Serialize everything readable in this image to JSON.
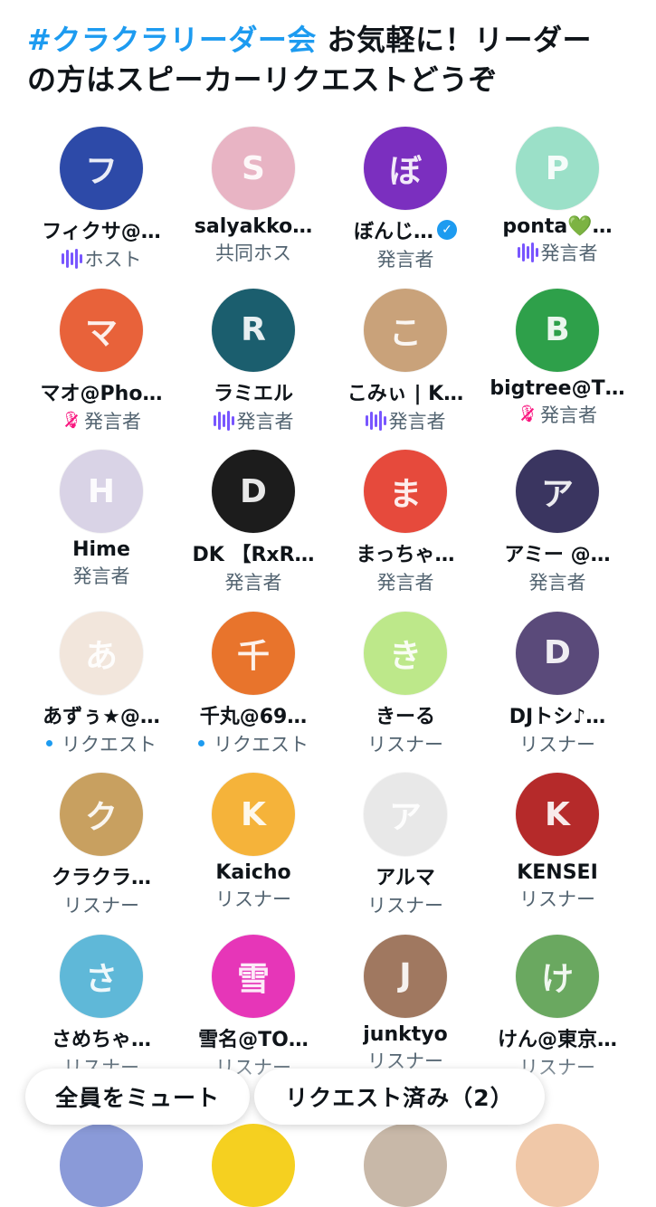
{
  "header": {
    "hashtag": "#クラクラリーダー会",
    "text": " お気軽に！リーダーの方はスピーカーリクエストどうぞ"
  },
  "participants": [
    {
      "name": "フィクサ@…",
      "role": "ホスト",
      "indicator": "wave",
      "avatar_color": "#2d4aa8",
      "avatar_glyph": "フ"
    },
    {
      "name": "salyakko…",
      "role": "共同ホス",
      "indicator": "none",
      "avatar_color": "#e8b4c4",
      "avatar_glyph": "S"
    },
    {
      "name": "ぼんじ…",
      "role": "発言者",
      "indicator": "none",
      "verified": true,
      "avatar_color": "#7b2fbf",
      "avatar_glyph": "ぼ"
    },
    {
      "name": "ponta💚…",
      "role": "発言者",
      "indicator": "wave",
      "avatar_color": "#9be0c8",
      "avatar_glyph": "P"
    },
    {
      "name": "マオ@Pho…",
      "role": "発言者",
      "indicator": "muted",
      "avatar_color": "#e8623a",
      "avatar_glyph": "マ"
    },
    {
      "name": "ラミエル",
      "role": "発言者",
      "indicator": "wave",
      "avatar_color": "#1b5e6e",
      "avatar_glyph": "R"
    },
    {
      "name": "こみぃ | K…",
      "role": "発言者",
      "indicator": "wave",
      "avatar_color": "#c9a27a",
      "avatar_glyph": "こ"
    },
    {
      "name": "bigtree@T…",
      "role": "発言者",
      "indicator": "muted",
      "avatar_color": "#2ea04a",
      "avatar_glyph": "B"
    },
    {
      "name": "Hime",
      "role": "発言者",
      "indicator": "none",
      "avatar_color": "#d9d3e6",
      "avatar_glyph": "H"
    },
    {
      "name": "DK 【RxR…",
      "role": "発言者",
      "indicator": "none",
      "avatar_color": "#1c1c1c",
      "avatar_glyph": "D"
    },
    {
      "name": "まっちゃ…",
      "role": "発言者",
      "indicator": "none",
      "avatar_color": "#e64a3c",
      "avatar_glyph": "ま"
    },
    {
      "name": "アミー @…",
      "role": "発言者",
      "indicator": "none",
      "avatar_color": "#3a3560",
      "avatar_glyph": "ア"
    },
    {
      "name": "あずぅ★@…",
      "role": "リクエスト",
      "indicator": "dot",
      "avatar_color": "#f2e6dc",
      "avatar_glyph": "あ"
    },
    {
      "name": "千丸@69…",
      "role": "リクエスト",
      "indicator": "dot",
      "avatar_color": "#e8742c",
      "avatar_glyph": "千"
    },
    {
      "name": "きーる",
      "role": "リスナー",
      "indicator": "none",
      "avatar_color": "#bde88a",
      "avatar_glyph": "き"
    },
    {
      "name": "DJトシ♪…",
      "role": "リスナー",
      "indicator": "none",
      "avatar_color": "#5a4a7a",
      "avatar_glyph": "D"
    },
    {
      "name": "クラクラ…",
      "role": "リスナー",
      "indicator": "none",
      "avatar_color": "#c8a060",
      "avatar_glyph": "ク"
    },
    {
      "name": "Kaicho",
      "role": "リスナー",
      "indicator": "none",
      "avatar_color": "#f5b33a",
      "avatar_glyph": "K"
    },
    {
      "name": "アルマ",
      "role": "リスナー",
      "indicator": "none",
      "avatar_color": "#e8e8e8",
      "avatar_glyph": "ア"
    },
    {
      "name": "KENSEI",
      "role": "リスナー",
      "indicator": "none",
      "avatar_color": "#b52a2a",
      "avatar_glyph": "K"
    },
    {
      "name": "さめちゃ…",
      "role": "リスナー",
      "indicator": "none",
      "avatar_color": "#5fb8d8",
      "avatar_glyph": "さ"
    },
    {
      "name": "雪名@TO…",
      "role": "リスナー",
      "indicator": "none",
      "avatar_color": "#e636b8",
      "avatar_glyph": "雪"
    },
    {
      "name": "junktyo",
      "role": "リスナー",
      "indicator": "none",
      "avatar_color": "#a07860",
      "avatar_glyph": "J"
    },
    {
      "name": "けん@東京…",
      "role": "リスナー",
      "indicator": "none",
      "avatar_color": "#6aa860",
      "avatar_glyph": "け"
    }
  ],
  "peek_avatars": [
    {
      "color": "#8a9ad8"
    },
    {
      "color": "#f5d020"
    },
    {
      "color": "#c8b8a8"
    },
    {
      "color": "#f0c8a8"
    }
  ],
  "actions": {
    "mute_all": "全員をミュート",
    "requested": "リクエスト済み（2）"
  }
}
